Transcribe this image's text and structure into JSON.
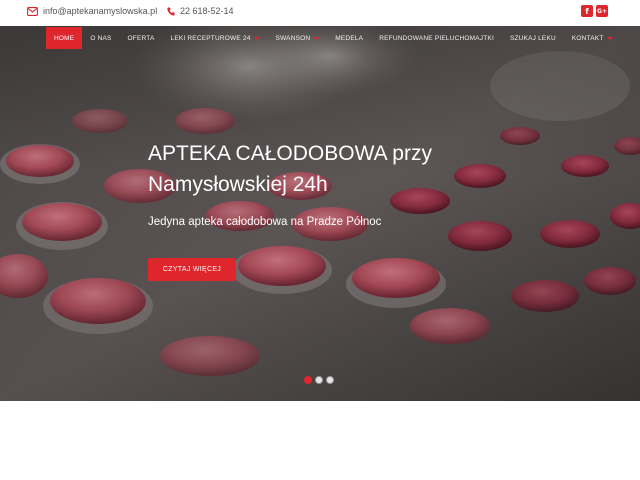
{
  "contact": {
    "email": "info@aptekanamyslowska.pl",
    "phone": "22 618-52-14",
    "email_icon": "envelope-icon",
    "phone_icon": "phone-icon"
  },
  "social": {
    "facebook_label": "f",
    "googleplus_label": "G+"
  },
  "nav": {
    "items": [
      {
        "label": "HOME",
        "active": true,
        "dropdown": false
      },
      {
        "label": "O NAS",
        "active": false,
        "dropdown": false
      },
      {
        "label": "OFERTA",
        "active": false,
        "dropdown": false
      },
      {
        "label": "LEKI RECEPTUROWE 24",
        "active": false,
        "dropdown": true
      },
      {
        "label": "SWANSON",
        "active": false,
        "dropdown": true
      },
      {
        "label": "MEDELA",
        "active": false,
        "dropdown": false
      },
      {
        "label": "REFUNDOWANE PIELUCHOMAJTKI",
        "active": false,
        "dropdown": false
      },
      {
        "label": "SZUKAJ LEKU",
        "active": false,
        "dropdown": false
      },
      {
        "label": "KONTAKT",
        "active": false,
        "dropdown": true
      }
    ]
  },
  "hero": {
    "title_line1": "APTEKA CAŁODOBOWA przy",
    "title_line2": "Namysłowskiej 24h",
    "subtitle": "Jedyna apteka całodobowa na Pradze Północ",
    "cta_label": "CZYTAJ WIĘCEJ",
    "slides": 3,
    "active_slide": 1
  },
  "colors": {
    "accent": "#e0262d",
    "pill": "#b4505e",
    "background_dark": "#3a3636"
  }
}
